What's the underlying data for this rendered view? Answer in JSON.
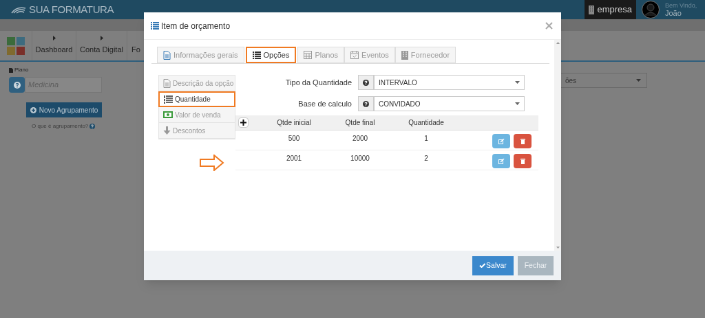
{
  "header": {
    "logo": "SUA FORMATURA",
    "company": "empresa",
    "welcome": "Bem Vindo,",
    "user": "João"
  },
  "nav": [
    "Dashboard",
    "Conta Digital",
    "Fo"
  ],
  "page": {
    "plan_label": "Plano",
    "plan_placeholder": "Medicina",
    "new_group_button": "Novo Agrupamento",
    "help_link": "O que é agrupamento?",
    "right_select": "ões"
  },
  "modal": {
    "title": "Item de orçamento",
    "tabs": [
      {
        "label": "Informações gerais",
        "selected": false
      },
      {
        "label": "Opções",
        "selected": true
      },
      {
        "label": "Planos",
        "selected": false
      },
      {
        "label": "Eventos",
        "selected": false
      },
      {
        "label": "Fornecedor",
        "selected": false
      }
    ],
    "side_menu": [
      {
        "label": "Descrição da opção",
        "selected": false
      },
      {
        "label": "Quantidade",
        "selected": true
      },
      {
        "label": "Valor de venda",
        "selected": false
      },
      {
        "label": "Descontos",
        "selected": false
      }
    ],
    "fields": [
      {
        "label": "Tipo da Quantidade",
        "value": "INTERVALO"
      },
      {
        "label": "Base de calculo",
        "value": "CONVIDADO"
      }
    ],
    "table": {
      "columns": [
        "Qtde inicial",
        "Qtde final",
        "Quantidade"
      ],
      "rows": [
        [
          "500",
          "2000",
          "1"
        ],
        [
          "2001",
          "10000",
          "2"
        ]
      ]
    },
    "buttons": {
      "save": "Salvar",
      "close": "Fechar"
    }
  }
}
